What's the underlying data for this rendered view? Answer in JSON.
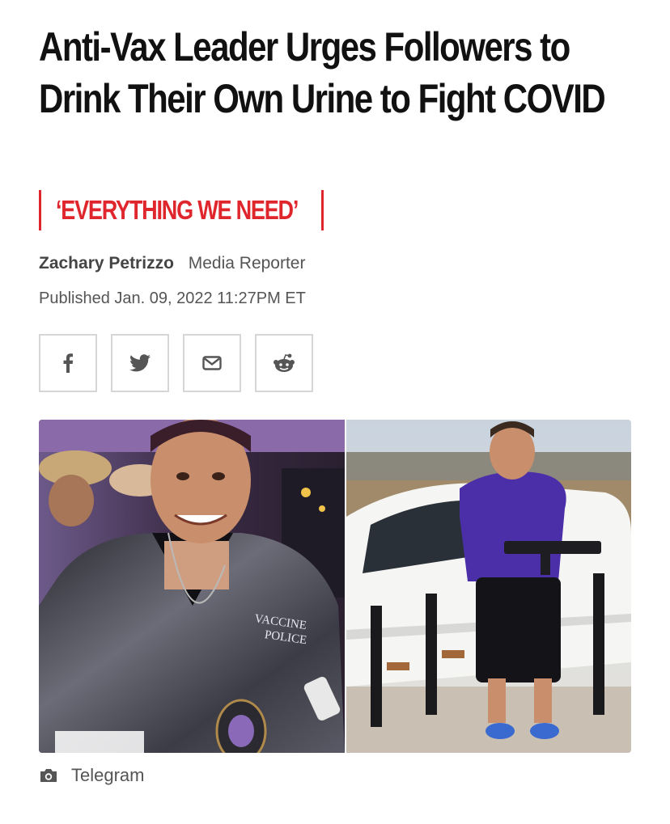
{
  "article": {
    "headline": "Anti-Vax Leader Urges Followers to Drink Their Own Urine to Fight COVID",
    "rubric": "‘EVERYTHING WE NEED’",
    "author": "Zachary Petrizzo",
    "author_title": "Media Reporter",
    "published": "Published Jan. 09, 2022 11:27PM ET"
  },
  "share": [
    {
      "name": "facebook",
      "icon": "facebook-icon"
    },
    {
      "name": "twitter",
      "icon": "twitter-icon"
    },
    {
      "name": "email",
      "icon": "mail-icon"
    },
    {
      "name": "reddit",
      "icon": "reddit-icon"
    }
  ],
  "photo": {
    "badge_text_line1": "VACCINE",
    "badge_text_line2": "POLICE",
    "credit": "Telegram",
    "credit_icon": "camera-icon"
  },
  "colors": {
    "accent": "#e0262d",
    "text": "#111111",
    "muted": "#555555",
    "border": "#d6d6d6",
    "shirt_purple": "#4b2fa8"
  }
}
